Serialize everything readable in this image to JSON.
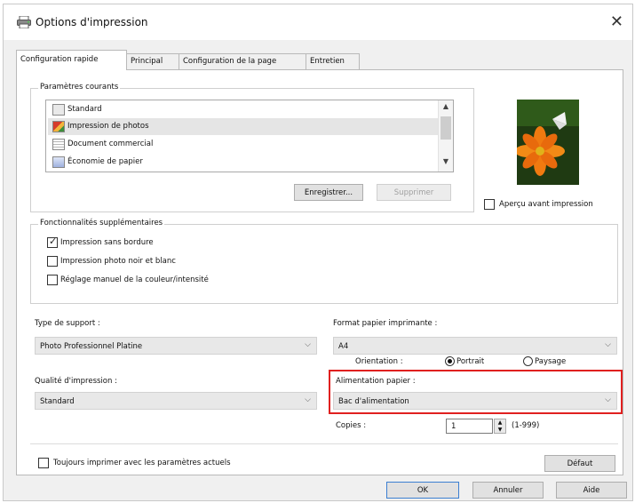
{
  "window": {
    "title": "Options d'impression",
    "close_glyph": "✕"
  },
  "tabs": [
    {
      "label": "Configuration rapide",
      "active": true
    },
    {
      "label": "Principal",
      "active": false
    },
    {
      "label": "Configuration de la page",
      "active": false
    },
    {
      "label": "Entretien",
      "active": false
    }
  ],
  "current_settings": {
    "legend": "Paramètres courants",
    "items": [
      {
        "label": "Standard",
        "icon": "standard-icon",
        "selected": false
      },
      {
        "label": "Impression de photos",
        "icon": "photo-icon",
        "selected": true
      },
      {
        "label": "Document commercial",
        "icon": "document-icon",
        "selected": false
      },
      {
        "label": "Économie de papier",
        "icon": "paper-saving-icon",
        "selected": false
      }
    ],
    "save_label": "Enregistrer...",
    "delete_label": "Supprimer"
  },
  "preview": {
    "checkbox_label": "Aperçu avant impression",
    "checked": false
  },
  "features": {
    "legend": "Fonctionnalités supplémentaires",
    "items": [
      {
        "label": "Impression sans bordure",
        "checked": true
      },
      {
        "label": "Impression photo noir et blanc",
        "checked": false
      },
      {
        "label": "Réglage manuel de la couleur/intensité",
        "checked": false
      }
    ]
  },
  "media_type": {
    "label": "Type de support :",
    "value": "Photo Professionnel Platine"
  },
  "paper_size": {
    "label": "Format papier imprimante :",
    "value": "A4"
  },
  "orientation": {
    "label": "Orientation :",
    "options": [
      {
        "label": "Portrait",
        "selected": true
      },
      {
        "label": "Paysage",
        "selected": false
      }
    ]
  },
  "print_quality": {
    "label": "Qualité d'impression :",
    "value": "Standard"
  },
  "paper_source": {
    "label": "Alimentation papier :",
    "value": "Bac d'alimentation"
  },
  "copies": {
    "label": "Copies :",
    "value": "1",
    "range": "(1-999)"
  },
  "always_print": {
    "label": "Toujours imprimer avec les paramètres actuels",
    "checked": false
  },
  "buttons": {
    "default": "Défaut",
    "ok": "OK",
    "cancel": "Annuler",
    "help": "Aide"
  },
  "colors": {
    "highlight": "#e0201f",
    "dialog_bg": "#f0f0f0",
    "selection_bg": "#e5e5e5"
  }
}
